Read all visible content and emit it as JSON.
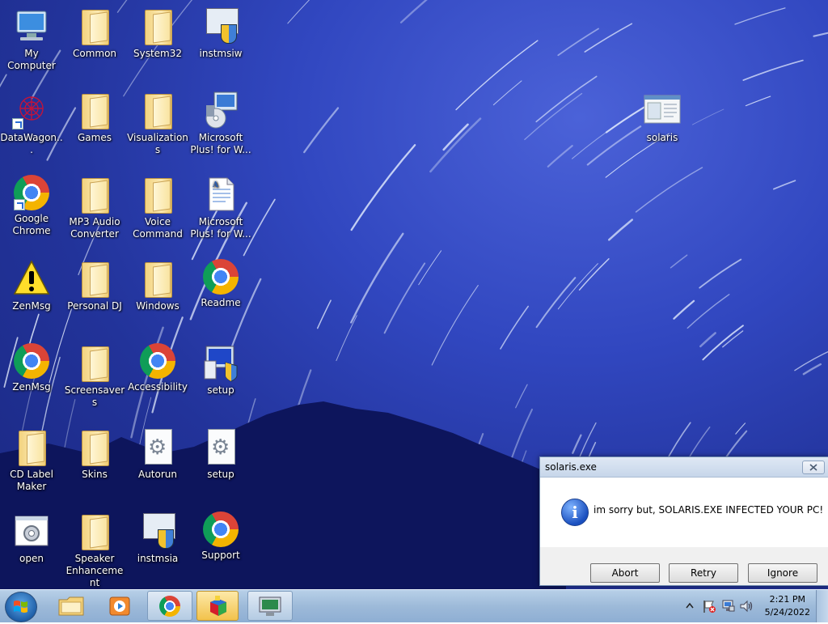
{
  "desktop": {
    "icons": [
      {
        "label": "My Computer"
      },
      {
        "label": "Common"
      },
      {
        "label": "System32"
      },
      {
        "label": "instmsiw"
      },
      {
        "label": "DataWagon..."
      },
      {
        "label": "Games"
      },
      {
        "label": "Visualizations"
      },
      {
        "label": "Microsoft Plus! for W..."
      },
      {
        "label": "Google Chrome"
      },
      {
        "label": "MP3 Audio Converter"
      },
      {
        "label": "Voice Command"
      },
      {
        "label": "Microsoft Plus! for W..."
      },
      {
        "label": "ZenMsg"
      },
      {
        "label": "Personal DJ"
      },
      {
        "label": "Windows"
      },
      {
        "label": "Readme"
      },
      {
        "label": "ZenMsg"
      },
      {
        "label": "Screensavers"
      },
      {
        "label": "Accessibility"
      },
      {
        "label": "setup"
      },
      {
        "label": "CD Label Maker"
      },
      {
        "label": "Skins"
      },
      {
        "label": "Autorun"
      },
      {
        "label": "setup"
      },
      {
        "label": "open"
      },
      {
        "label": "Speaker Enhancement"
      },
      {
        "label": "instmsia"
      },
      {
        "label": "Support"
      },
      {
        "label": "solaris"
      }
    ]
  },
  "dialog": {
    "title": "solaris.exe",
    "message": "im sorry but, SOLARIS.EXE INFECTED YOUR PC!",
    "buttons": {
      "abort": "Abort",
      "retry": "Retry",
      "ignore": "Ignore"
    }
  },
  "taskbar": {
    "clock_time": "2:21 PM",
    "clock_date": "5/24/2022"
  },
  "colors": {
    "dialog_border": "#6f8cb0",
    "taskbar": "#9dbad9",
    "desktop_bg": "#2a3cb0"
  }
}
